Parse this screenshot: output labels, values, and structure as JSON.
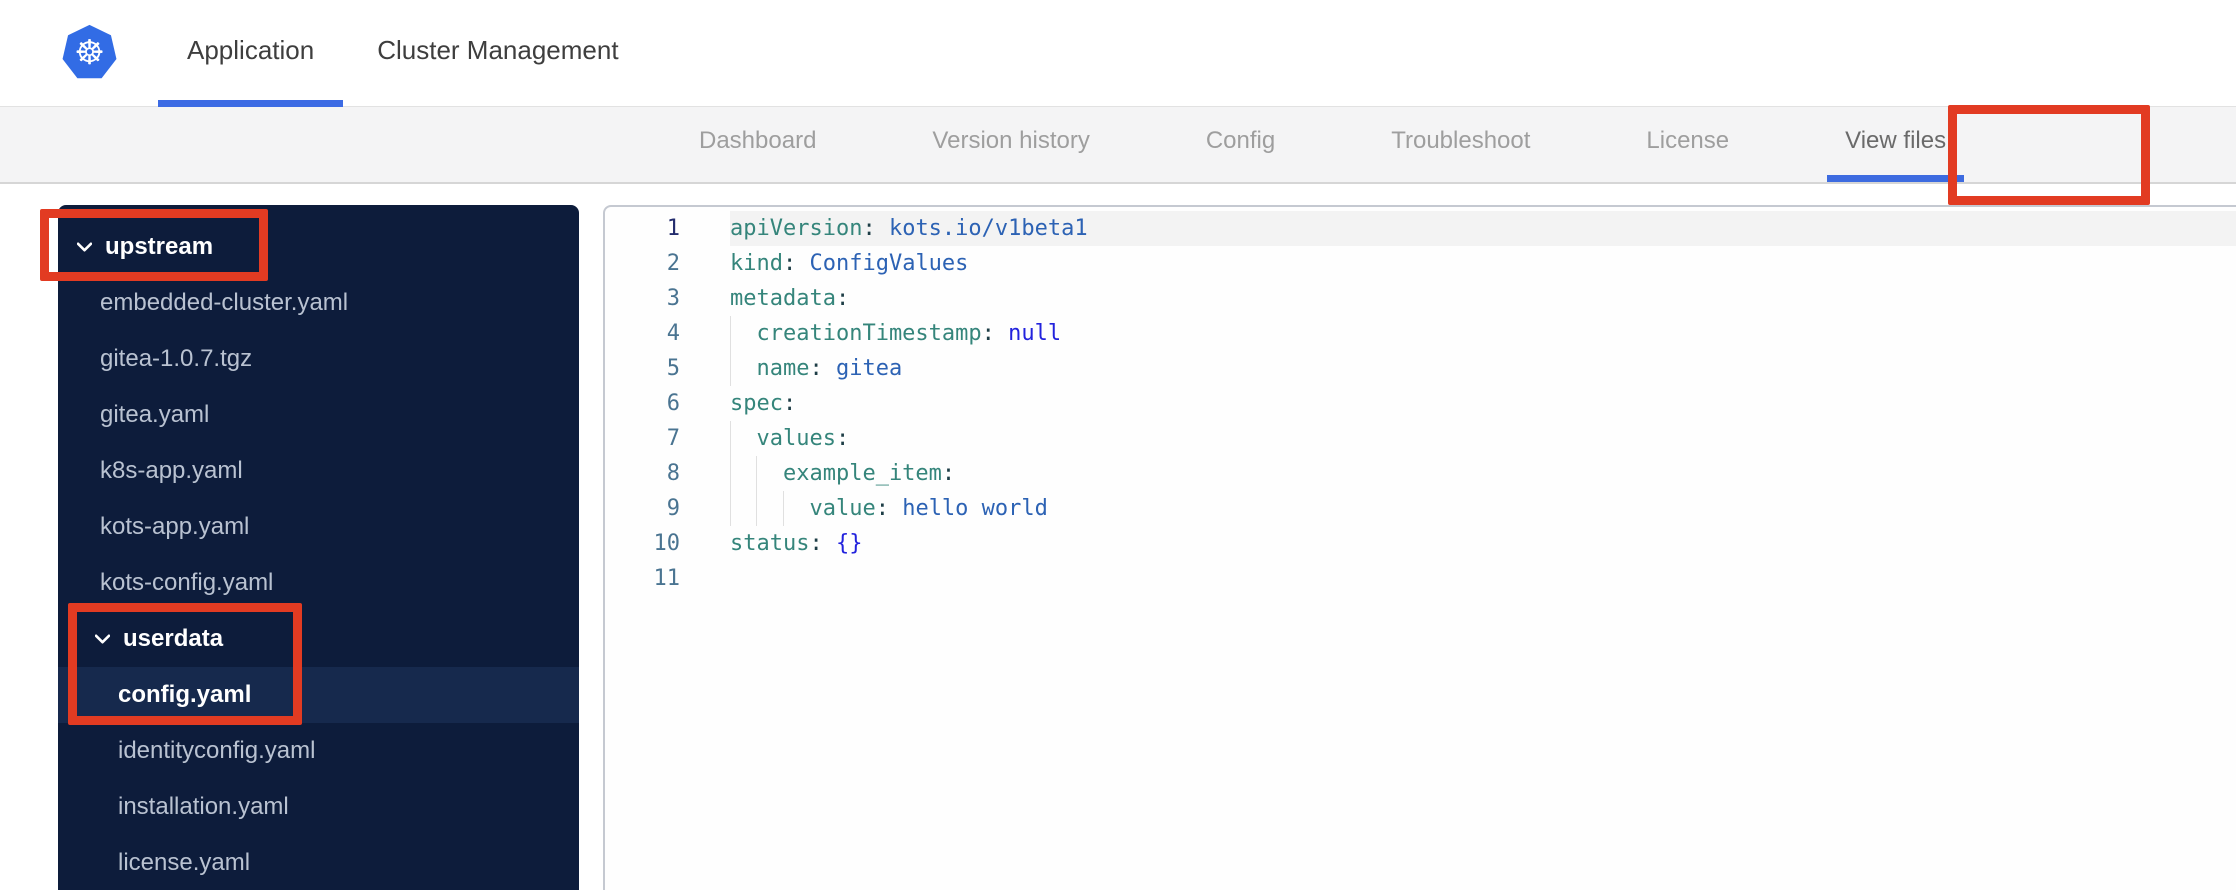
{
  "header": {
    "logo_icon": "kubernetes-logo",
    "tabs": [
      {
        "label": "Application",
        "active": true
      },
      {
        "label": "Cluster Management",
        "active": false
      }
    ]
  },
  "nav": {
    "tabs": [
      {
        "label": "Dashboard",
        "active": false
      },
      {
        "label": "Version history",
        "active": false
      },
      {
        "label": "Config",
        "active": false
      },
      {
        "label": "Troubleshoot",
        "active": false
      },
      {
        "label": "License",
        "active": false
      },
      {
        "label": "View files",
        "active": true
      }
    ]
  },
  "file_tree": {
    "items": [
      {
        "label": "upstream",
        "kind": "folder",
        "level": 1,
        "expanded": true
      },
      {
        "label": "embedded-cluster.yaml",
        "kind": "file",
        "level": 1
      },
      {
        "label": "gitea-1.0.7.tgz",
        "kind": "file",
        "level": 1
      },
      {
        "label": "gitea.yaml",
        "kind": "file",
        "level": 1
      },
      {
        "label": "k8s-app.yaml",
        "kind": "file",
        "level": 1
      },
      {
        "label": "kots-app.yaml",
        "kind": "file",
        "level": 1
      },
      {
        "label": "kots-config.yaml",
        "kind": "file",
        "level": 1
      },
      {
        "label": "userdata",
        "kind": "folder",
        "level": 2,
        "expanded": true
      },
      {
        "label": "config.yaml",
        "kind": "file",
        "level": 2,
        "selected": true
      },
      {
        "label": "identityconfig.yaml",
        "kind": "file",
        "level": 2
      },
      {
        "label": "installation.yaml",
        "kind": "file",
        "level": 2
      },
      {
        "label": "license.yaml",
        "kind": "file",
        "level": 2
      }
    ]
  },
  "editor": {
    "language": "yaml",
    "lines": [
      {
        "n": 1,
        "active": true,
        "tokens": [
          {
            "t": "apiVersion",
            "c": "key"
          },
          {
            "t": ":",
            "c": "pun"
          },
          {
            "t": " kots.io/v1beta1",
            "c": "val"
          }
        ]
      },
      {
        "n": 2,
        "tokens": [
          {
            "t": "kind",
            "c": "key"
          },
          {
            "t": ":",
            "c": "pun"
          },
          {
            "t": " ConfigValues",
            "c": "val"
          }
        ]
      },
      {
        "n": 3,
        "tokens": [
          {
            "t": "metadata",
            "c": "key"
          },
          {
            "t": ":",
            "c": "pun"
          }
        ]
      },
      {
        "n": 4,
        "tokens": [
          {
            "t": "  creationTimestamp",
            "c": "key"
          },
          {
            "t": ":",
            "c": "pun"
          },
          {
            "t": " null",
            "c": "kw"
          }
        ]
      },
      {
        "n": 5,
        "tokens": [
          {
            "t": "  name",
            "c": "key"
          },
          {
            "t": ":",
            "c": "pun"
          },
          {
            "t": " gitea",
            "c": "val"
          }
        ]
      },
      {
        "n": 6,
        "tokens": [
          {
            "t": "spec",
            "c": "key"
          },
          {
            "t": ":",
            "c": "pun"
          }
        ]
      },
      {
        "n": 7,
        "tokens": [
          {
            "t": "  values",
            "c": "key"
          },
          {
            "t": ":",
            "c": "pun"
          }
        ]
      },
      {
        "n": 8,
        "tokens": [
          {
            "t": "    example_item",
            "c": "key"
          },
          {
            "t": ":",
            "c": "pun"
          }
        ]
      },
      {
        "n": 9,
        "tokens": [
          {
            "t": "      value",
            "c": "key"
          },
          {
            "t": ":",
            "c": "pun"
          },
          {
            "t": " hello world",
            "c": "val"
          }
        ]
      },
      {
        "n": 10,
        "tokens": [
          {
            "t": "status",
            "c": "key"
          },
          {
            "t": ":",
            "c": "pun"
          },
          {
            "t": " {}",
            "c": "kw"
          }
        ]
      },
      {
        "n": 11,
        "tokens": []
      }
    ]
  },
  "annotations": {
    "color": "#e23b22",
    "boxes": [
      "view-files-tab",
      "upstream-folder",
      "userdata-config-yaml"
    ]
  },
  "colors": {
    "kubernetes_blue": "#326ce5",
    "tab_underline_blue": "#3c6be4",
    "sidebar_navy": "#0d1c3b",
    "sidebar_selected_navy": "#16294d",
    "yaml_key_teal": "#35857b",
    "yaml_value_blue": "#2c62b4",
    "yaml_keyword_blue": "#2222dd",
    "annotation_red": "#e23b22"
  }
}
